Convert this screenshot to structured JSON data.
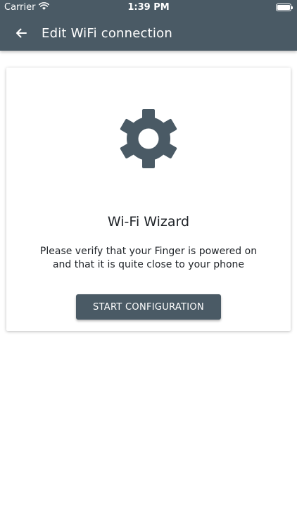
{
  "status_bar": {
    "carrier": "Carrier",
    "time": "1:39 PM",
    "wifi_icon": "wifi-icon",
    "battery_icon": "battery-icon"
  },
  "app_bar": {
    "back_icon": "arrow-left-icon",
    "title": "Edit WiFi connection"
  },
  "card": {
    "icon": "gear-icon",
    "title": "Wi-Fi Wizard",
    "text": "Please verify that your Finger is powered on and that it is quite close to your phone",
    "button_label": "START CONFIGURATION"
  },
  "colors": {
    "primary": "#4a5a65",
    "background": "#ffffff",
    "text": "#1f2328"
  }
}
